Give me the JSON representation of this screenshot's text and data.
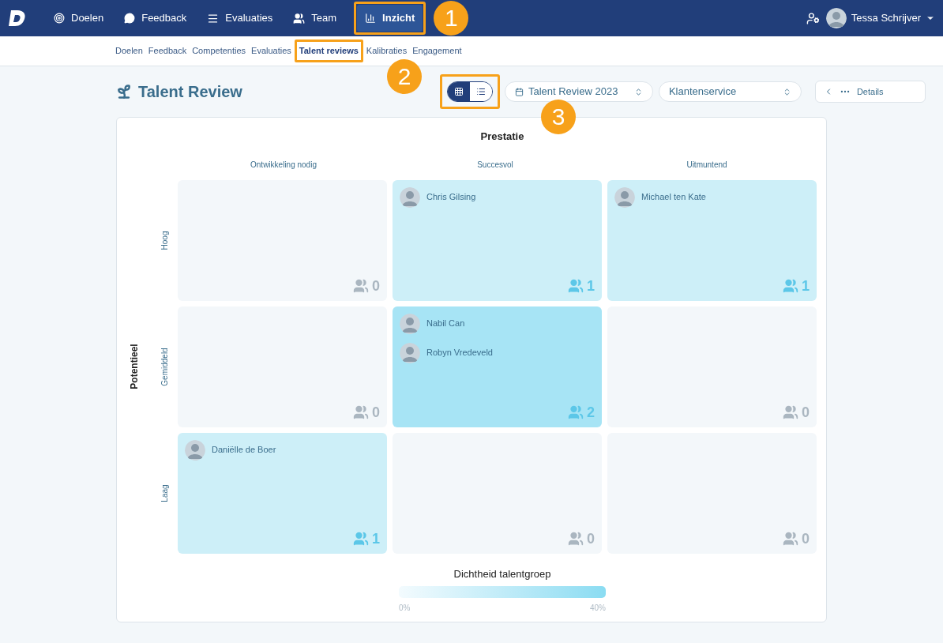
{
  "nav": {
    "items": [
      {
        "kind": "target",
        "label": "Doelen",
        "selected": false
      },
      {
        "kind": "chat",
        "label": "Feedback",
        "selected": false
      },
      {
        "kind": "list",
        "label": "Evaluaties",
        "selected": false
      },
      {
        "kind": "users",
        "label": "Team",
        "selected": false
      },
      {
        "kind": "chart",
        "label": "Inzicht",
        "selected": true
      }
    ],
    "user": {
      "name": "Tessa Schrijver"
    }
  },
  "subnav": [
    {
      "label": "Doelen",
      "selected": false
    },
    {
      "label": "Feedback",
      "selected": false
    },
    {
      "label": "Competenties",
      "selected": false
    },
    {
      "label": "Evaluaties",
      "selected": false
    },
    {
      "label": "Talent reviews",
      "selected": true
    },
    {
      "label": "Kalibraties",
      "selected": false
    },
    {
      "label": "Engagement",
      "selected": false
    }
  ],
  "annotations": [
    "1",
    "2",
    "3"
  ],
  "title": "Talent Review",
  "view_toggle": [
    {
      "kind": "grid",
      "selected": true
    },
    {
      "kind": "list",
      "selected": false
    }
  ],
  "filters": [
    {
      "kind": "date",
      "value": "Talent Review 2023"
    },
    {
      "kind": "plain",
      "value": "Klantenservice"
    }
  ],
  "details_button": "Details",
  "matrix": {
    "x_title": "Prestatie",
    "y_title": "Potentieel",
    "columns": [
      "Ontwikkeling nodig",
      "Succesvol",
      "Uitmuntend"
    ],
    "rows": [
      {
        "label": "Hoog",
        "cells": [
          {
            "count": "0",
            "color": "#f3f7fa"
          },
          {
            "people": [
              "Chris Gilsing"
            ],
            "count": "1",
            "color": "#cdeff8"
          },
          {
            "people": [
              "Michael ten Kate"
            ],
            "count": "1",
            "color": "#cdeff8"
          }
        ]
      },
      {
        "label": "Gemiddeld",
        "cells": [
          {
            "count": "0",
            "color": "#f3f7fa"
          },
          {
            "people": [
              "Nabil Can",
              "Robyn Vredeveld"
            ],
            "count": "2",
            "color": "#a7e4f5"
          },
          {
            "count": "0",
            "color": "#f3f7fa"
          }
        ]
      },
      {
        "label": "Laag",
        "cells": [
          {
            "people": [
              "Daniëlle de Boer"
            ],
            "count": "1",
            "color": "#cdeff8"
          },
          {
            "count": "0",
            "color": "#f3f7fa"
          },
          {
            "count": "0",
            "color": "#f3f7fa"
          }
        ]
      }
    ]
  },
  "legend": {
    "title": "Dichtheid talentgroep",
    "min": "0%",
    "max": "40%"
  }
}
